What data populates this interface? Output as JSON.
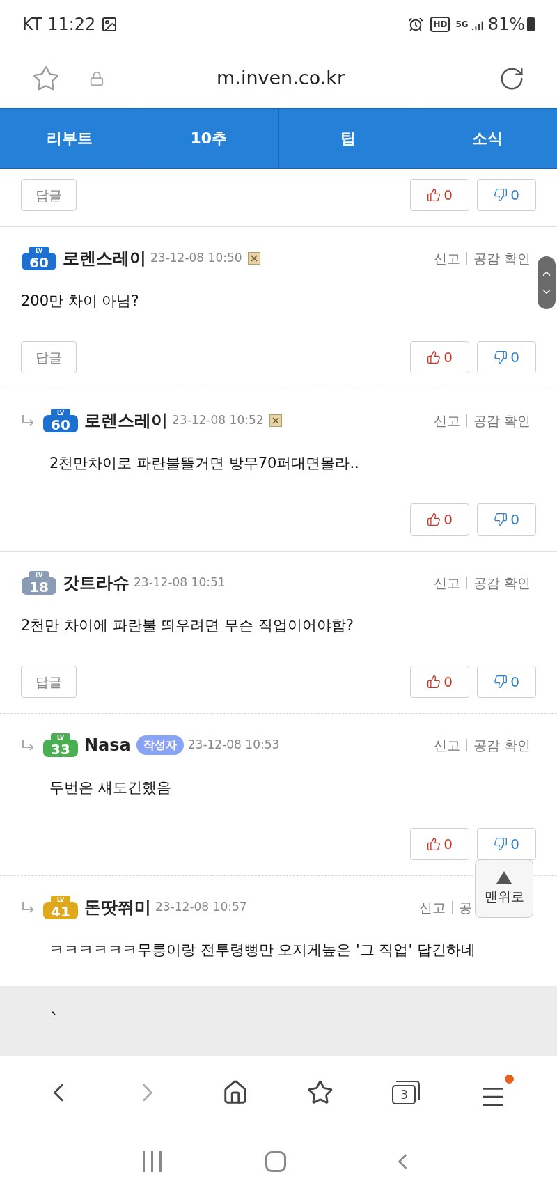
{
  "status_bar": {
    "carrier_time": "KT 11:22",
    "network": "5G",
    "hd": "HD",
    "battery": "81%"
  },
  "address_bar": {
    "url": "m.inven.co.kr"
  },
  "tabs": [
    {
      "label": "리부트"
    },
    {
      "label": "10추"
    },
    {
      "label": "팁"
    },
    {
      "label": "소식"
    }
  ],
  "comments": [
    {
      "kind": "actions_only",
      "reply_button": "답글",
      "likes": "0",
      "dislikes": "0"
    },
    {
      "kind": "comment",
      "badge": {
        "label": "LV",
        "number": "60",
        "color": "#1d6fd0"
      },
      "name": "로렌스레이",
      "time": "23-12-08 10:50",
      "image_icon": true,
      "links": [
        "신고",
        "공감 확인"
      ],
      "body": "200만 차이 아님?",
      "reply_button": "답글",
      "likes": "0",
      "dislikes": "0"
    },
    {
      "kind": "reply",
      "badge": {
        "label": "LV",
        "number": "60",
        "color": "#1d6fd0"
      },
      "name": "로렌스레이",
      "time": "23-12-08 10:52",
      "image_icon": true,
      "links": [
        "신고",
        "공감 확인"
      ],
      "body": "2천만차이로 파란불뜰거면 방무70퍼대면몰라..",
      "likes": "0",
      "dislikes": "0"
    },
    {
      "kind": "comment",
      "badge": {
        "label": "LV",
        "number": "18",
        "color": "#8a9bb4"
      },
      "name": "갓트라슈",
      "time": "23-12-08 10:51",
      "image_icon": false,
      "links": [
        "신고",
        "공감 확인"
      ],
      "body": "2천만 차이에 파란불 띄우려면 무슨 직업이어야함?",
      "reply_button": "답글",
      "likes": "0",
      "dislikes": "0"
    },
    {
      "kind": "reply",
      "badge": {
        "label": "LV",
        "number": "33",
        "color": "#4cae52"
      },
      "name": "Nasa",
      "author_tag": "작성자",
      "time": "23-12-08 10:53",
      "image_icon": false,
      "links": [
        "신고",
        "공감 확인"
      ],
      "body": "두번은 섀도긴했음",
      "likes": "0",
      "dislikes": "0"
    },
    {
      "kind": "reply",
      "badge": {
        "label": "LV",
        "number": "41",
        "color": "#e0a81c"
      },
      "name": "돈땃쮜미",
      "time": "23-12-08 10:57",
      "image_icon": false,
      "links": [
        "신고",
        "공"
      ],
      "cut_by_top_button": true,
      "body": "ㅋㅋㅋㅋㅋㅋ무릉이랑 전투령뻥만 오지게높은 '그 직업' 답긴하네"
    }
  ],
  "footer_note": "`",
  "top_button": {
    "label": "맨위로"
  },
  "browser_toolbar": {
    "tab_count": "3",
    "menu_notification": true
  }
}
